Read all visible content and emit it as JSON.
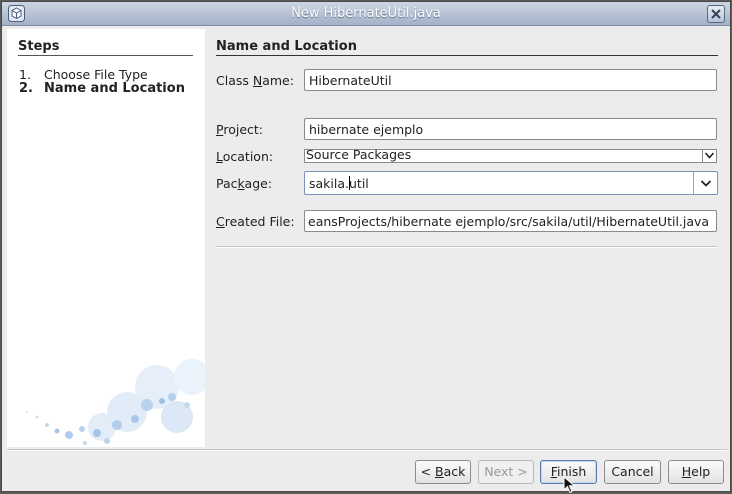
{
  "window": {
    "title": "New HibernateUtil.java"
  },
  "steps": {
    "title": "Steps",
    "items": [
      {
        "num": "1.",
        "label": "Choose File Type",
        "current": false
      },
      {
        "num": "2.",
        "label": "Name and Location",
        "current": true
      }
    ]
  },
  "form": {
    "section_title": "Name and Location",
    "class_name": {
      "label_pre": "Class ",
      "label_mn": "N",
      "label_post": "ame:",
      "value": "HibernateUtil"
    },
    "project": {
      "label_pre": "",
      "label_mn": "P",
      "label_post": "roject:",
      "value": "hibernate  ejemplo"
    },
    "location": {
      "label_pre": "",
      "label_mn": "L",
      "label_post": "ocation:",
      "value": "Source Packages"
    },
    "package": {
      "label_pre": "Pac",
      "label_mn": "k",
      "label_post": "age:",
      "value_before_caret": "sakila.",
      "value_after_caret": "util"
    },
    "created_file": {
      "label_pre": "",
      "label_mn": "C",
      "label_post": "reated File:",
      "value": "eansProjects/hibernate  ejemplo/src/sakila/util/HibernateUtil.java"
    }
  },
  "buttons": {
    "back": {
      "pre": "< ",
      "mn": "B",
      "post": "ack"
    },
    "next": {
      "label": "Next >"
    },
    "finish": {
      "pre": "",
      "mn": "F",
      "post": "inish"
    },
    "cancel": {
      "label": "Cancel"
    },
    "help": {
      "pre": "",
      "mn": "H",
      "post": "elp"
    }
  },
  "colors": {
    "titlebar": "#a3b2c8",
    "panel": "#ffffff",
    "dialog_bg": "#ececec",
    "focus_border": "#7d94b8"
  }
}
